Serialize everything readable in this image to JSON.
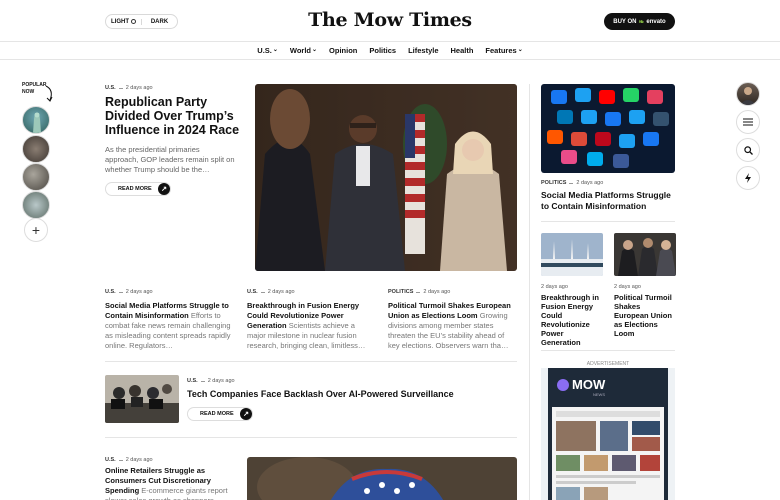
{
  "header": {
    "theme_light": "LIGHT",
    "theme_dark": "DARK",
    "logo": "The Mow Times",
    "buy_prefix": "BUY ON",
    "buy_brand": "envato"
  },
  "nav": {
    "items": [
      {
        "label": "U.S.",
        "dropdown": true
      },
      {
        "label": "World",
        "dropdown": true
      },
      {
        "label": "Opinion",
        "dropdown": false
      },
      {
        "label": "Politics",
        "dropdown": false
      },
      {
        "label": "Lifestyle",
        "dropdown": false
      },
      {
        "label": "Health",
        "dropdown": false
      },
      {
        "label": "Features",
        "dropdown": true
      }
    ]
  },
  "popular": {
    "line1": "POPULAR",
    "line2": "NOW"
  },
  "hero": {
    "category": "U.S.",
    "date": "2 days ago",
    "title": "Republican Party Divided Over Trump’s Influence in 2024 Race",
    "excerpt": "As the presidential primaries approach, GOP leaders remain split on whether Trump should be the…",
    "read_more": "READ MORE"
  },
  "stories": [
    {
      "category": "U.S.",
      "date": "2 days ago",
      "title": "Social Media Platforms Struggle to Contain Misinformation",
      "excerpt": "Efforts to combat fake news remain challenging as misleading content spreads rapidly online. Regulators…"
    },
    {
      "category": "U.S.",
      "date": "2 days ago",
      "title": "Breakthrough in Fusion Energy Could Revolutionize Power Generation",
      "excerpt": "Scientists achieve a major milestone in nuclear fusion research, bringing clean, limitless…"
    },
    {
      "category": "POLITICS",
      "date": "2 days ago",
      "title": "Political Turmoil Shakes European Union as Elections Loom",
      "excerpt": "Growing divisions among member states threaten the EU’s stability ahead of key elections. Observers warn tha…"
    }
  ],
  "tech": {
    "category": "U.S.",
    "date": "2 days ago",
    "title": "Tech Companies Face Backlash Over AI-Powered Surveillance",
    "read_more": "READ MORE"
  },
  "retail": {
    "category": "U.S.",
    "date": "2 days ago",
    "title": "Online Retailers Struggle as Consumers Cut Discretionary Spending",
    "excerpt": "E-commerce giants report slower sales growth as shoppers"
  },
  "sidebar": {
    "feature": {
      "category": "POLITICS",
      "date": "2 days ago",
      "title": "Social Media Platforms Struggle to Contain Misinformation"
    },
    "mini": [
      {
        "date": "2 days ago",
        "title": "Breakthrough in Fusion Energy Could Revolutionize Power Generation"
      },
      {
        "date": "2 days ago",
        "title": "Political Turmoil Shakes European Union as Elections Loom"
      }
    ],
    "ad_label": "ADVERTISEMENT",
    "ad_brand": "MOW",
    "ad_sub": "NEWS"
  },
  "icons": {
    "menu": "menu-icon",
    "search": "search-icon",
    "flash": "lightning-icon",
    "plus": "plus-icon",
    "read_arrow": "arrow-up-right-icon"
  },
  "colors": {
    "accent": "#111111",
    "envato_green": "#82b541",
    "ad_bg": "#1e2a39"
  }
}
